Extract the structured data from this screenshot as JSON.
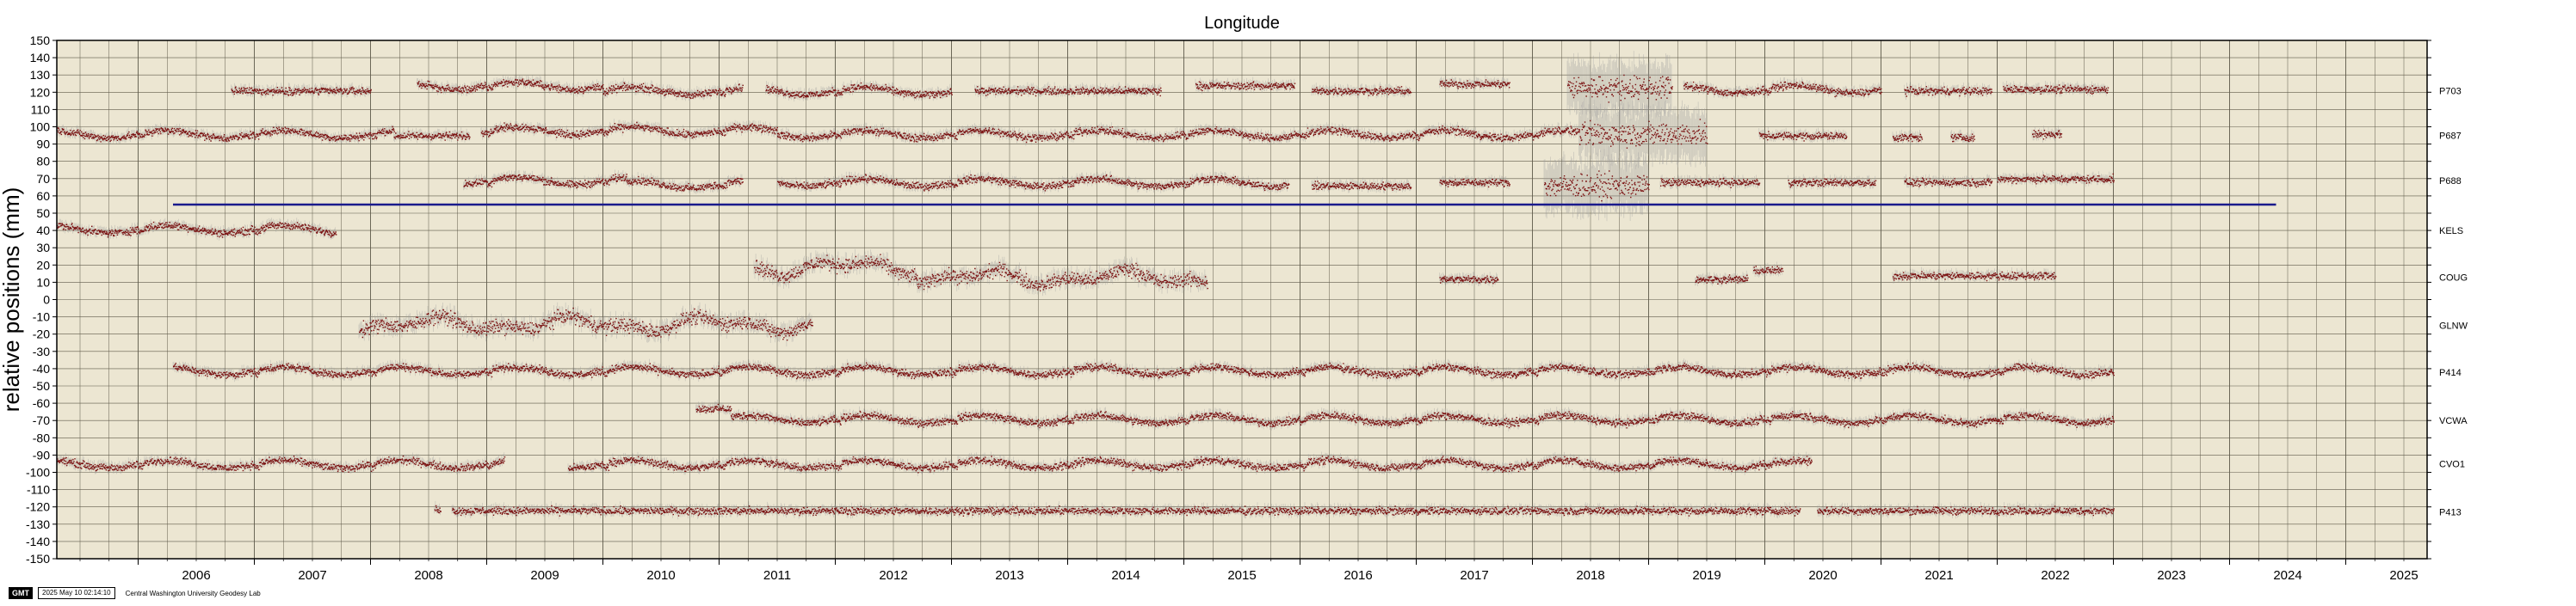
{
  "chart_data": {
    "type": "scatter",
    "title": "Longitude",
    "ylabel": "relative positions (mm)",
    "xlim": [
      2005.3,
      2025.7
    ],
    "ylim": [
      -150,
      150
    ],
    "yticks_step": 10,
    "xticks": [
      "2006",
      "2007",
      "2008",
      "2009",
      "2010",
      "2011",
      "2012",
      "2013",
      "2014",
      "2015",
      "2016",
      "2017",
      "2018",
      "2019",
      "2020",
      "2021",
      "2022",
      "2023",
      "2024",
      "2025"
    ],
    "grid": true,
    "background_color": "#ece6d2",
    "point_color": "#7a0f0f",
    "error_color": "#9c9c9c",
    "reference_line": {
      "y": 55,
      "x": [
        2006.3,
        2024.4
      ],
      "color": "#1a1a8c"
    },
    "series": [
      {
        "name": "P703",
        "label_y": 121,
        "segments": [
          {
            "x": [
              2006.8,
              2008.0
            ],
            "y": 121,
            "pattern": "flat"
          },
          {
            "x": [
              2008.4,
              2010.0
            ],
            "y": 124,
            "pattern": "sawtooth"
          },
          {
            "x": [
              2010.0,
              2011.2
            ],
            "y": 121,
            "pattern": "sawtooth"
          },
          {
            "x": [
              2011.4,
              2013.0
            ],
            "y": 121,
            "pattern": "sawtooth"
          },
          {
            "x": [
              2013.2,
              2014.8
            ],
            "y": 121,
            "pattern": "flat"
          },
          {
            "x": [
              2015.1,
              2015.95
            ],
            "y": 124,
            "pattern": "flat"
          },
          {
            "x": [
              2016.1,
              2016.95
            ],
            "y": 121,
            "pattern": "flat"
          },
          {
            "x": [
              2017.2,
              2017.8
            ],
            "y": 125,
            "pattern": "flat"
          },
          {
            "x": [
              2018.3,
              2019.2
            ],
            "y": 123,
            "pattern": "noisy"
          },
          {
            "x": [
              2019.3,
              2021.0
            ],
            "y": 122,
            "pattern": "sawtooth"
          },
          {
            "x": [
              2021.2,
              2021.95
            ],
            "y": 121,
            "pattern": "flat"
          },
          {
            "x": [
              2022.05,
              2022.95
            ],
            "y": 122,
            "pattern": "flat"
          }
        ]
      },
      {
        "name": "P687",
        "label_y": 95,
        "segments": [
          {
            "x": [
              2005.3,
              2008.2
            ],
            "y": 96,
            "pattern": "sawtooth"
          },
          {
            "x": [
              2008.2,
              2008.85
            ],
            "y": 95,
            "pattern": "flat"
          },
          {
            "x": [
              2008.95,
              2011.5
            ],
            "y": 98,
            "pattern": "sawtooth"
          },
          {
            "x": [
              2011.5,
              2016.0
            ],
            "y": 96,
            "pattern": "sawtooth"
          },
          {
            "x": [
              2016.0,
              2018.4
            ],
            "y": 96,
            "pattern": "sawtooth"
          },
          {
            "x": [
              2018.4,
              2019.5
            ],
            "y": 96,
            "pattern": "noisy"
          },
          {
            "x": [
              2019.95,
              2020.7
            ],
            "y": 95,
            "pattern": "flat"
          },
          {
            "x": [
              2021.1,
              2021.35
            ],
            "y": 94,
            "pattern": "flat"
          },
          {
            "x": [
              2021.6,
              2021.8
            ],
            "y": 94,
            "pattern": "flat"
          },
          {
            "x": [
              2022.3,
              2022.55
            ],
            "y": 96,
            "pattern": "flat"
          }
        ]
      },
      {
        "name": "P688",
        "label_y": 69,
        "segments": [
          {
            "x": [
              2008.8,
              2010.2
            ],
            "y": 69,
            "pattern": "sawtooth"
          },
          {
            "x": [
              2010.2,
              2011.2
            ],
            "y": 67,
            "pattern": "sawtooth"
          },
          {
            "x": [
              2011.5,
              2012.8
            ],
            "y": 68,
            "pattern": "sawtooth"
          },
          {
            "x": [
              2012.8,
              2015.9
            ],
            "y": 68,
            "pattern": "sawtooth"
          },
          {
            "x": [
              2016.1,
              2016.95
            ],
            "y": 66,
            "pattern": "flat"
          },
          {
            "x": [
              2017.2,
              2017.8
            ],
            "y": 68,
            "pattern": "flat"
          },
          {
            "x": [
              2018.1,
              2019.0
            ],
            "y": 66,
            "pattern": "noisy"
          },
          {
            "x": [
              2019.1,
              2019.95
            ],
            "y": 68,
            "pattern": "flat"
          },
          {
            "x": [
              2020.2,
              2020.95
            ],
            "y": 68,
            "pattern": "flat"
          },
          {
            "x": [
              2021.2,
              2021.95
            ],
            "y": 68,
            "pattern": "flat"
          },
          {
            "x": [
              2022.0,
              2023.0
            ],
            "y": 70,
            "pattern": "flat"
          }
        ]
      },
      {
        "name": "KELS",
        "label_y": 40,
        "segments": [
          {
            "x": [
              2005.3,
              2007.7
            ],
            "y": 41,
            "pattern": "sawtooth"
          }
        ]
      },
      {
        "name": "COUG",
        "label_y": 13,
        "segments": [
          {
            "x": [
              2011.3,
              2012.7
            ],
            "y": 19,
            "pattern": "wavy"
          },
          {
            "x": [
              2012.7,
              2015.2
            ],
            "y": 13,
            "pattern": "wavy"
          },
          {
            "x": [
              2017.2,
              2017.7
            ],
            "y": 12,
            "pattern": "flat"
          },
          {
            "x": [
              2019.4,
              2019.85
            ],
            "y": 12,
            "pattern": "flat"
          },
          {
            "x": [
              2019.9,
              2020.15
            ],
            "y": 17,
            "pattern": "flat"
          },
          {
            "x": [
              2021.1,
              2022.5
            ],
            "y": 14,
            "pattern": "flat"
          }
        ]
      },
      {
        "name": "GLNW",
        "label_y": -15,
        "segments": [
          {
            "x": [
              2007.9,
              2011.8
            ],
            "y": -14,
            "pattern": "wavy"
          }
        ]
      },
      {
        "name": "P414",
        "label_y": -42,
        "segments": [
          {
            "x": [
              2006.3,
              2023.0
            ],
            "y": -41,
            "pattern": "sawtooth"
          }
        ]
      },
      {
        "name": "VCWA",
        "label_y": -70,
        "segments": [
          {
            "x": [
              2010.8,
              2011.1
            ],
            "y": -63,
            "pattern": "flat"
          },
          {
            "x": [
              2011.1,
              2023.0
            ],
            "y": -69,
            "pattern": "sawtooth"
          }
        ]
      },
      {
        "name": "CVO1",
        "label_y": -95,
        "segments": [
          {
            "x": [
              2005.3,
              2009.15
            ],
            "y": -95,
            "pattern": "sawtooth"
          },
          {
            "x": [
              2009.7,
              2020.4
            ],
            "y": -95,
            "pattern": "sawtooth"
          }
        ]
      },
      {
        "name": "P413",
        "label_y": -123,
        "segments": [
          {
            "x": [
              2008.55,
              2008.6
            ],
            "y": -121,
            "pattern": "flat"
          },
          {
            "x": [
              2008.7,
              2020.3
            ],
            "y": -122,
            "pattern": "flat"
          },
          {
            "x": [
              2020.45,
              2023.0
            ],
            "y": -122,
            "pattern": "flat"
          }
        ]
      }
    ]
  },
  "footer": {
    "logo": "GMT",
    "timestamp": "2025 May 10 02:14:10",
    "organization": "Central Washington University Geodesy Lab"
  }
}
